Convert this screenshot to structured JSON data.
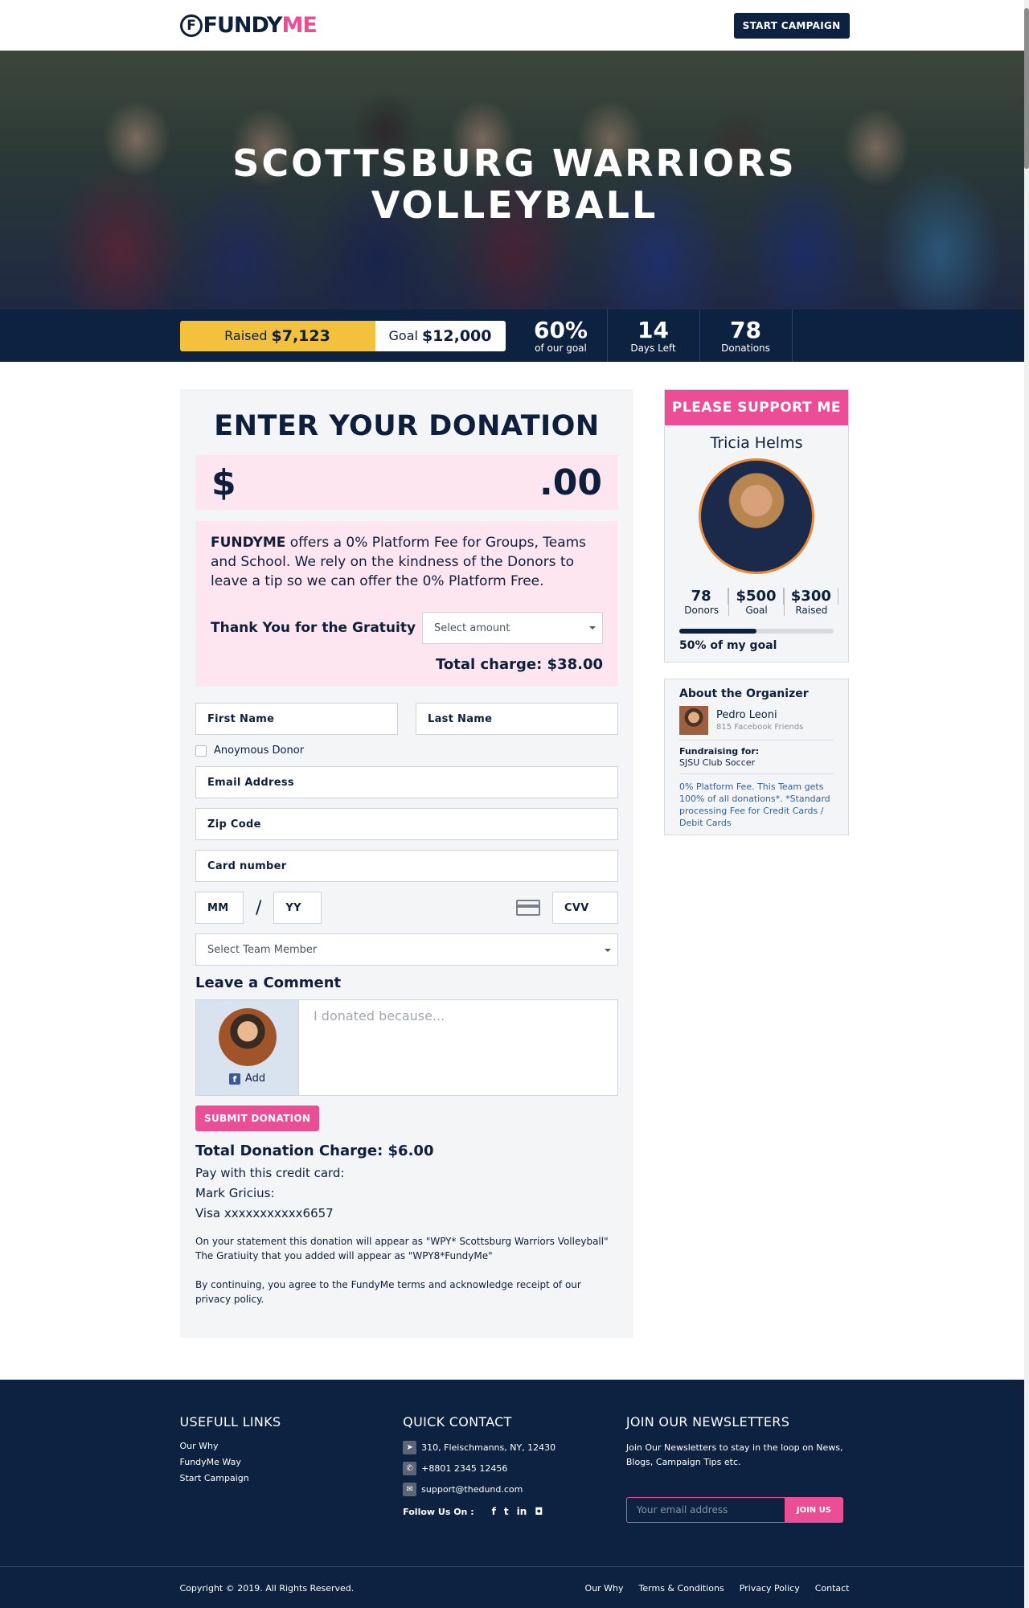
{
  "header": {
    "logo_mark": "F",
    "logo_fundy": "FUNDY",
    "logo_me": "ME",
    "start_campaign": "START CAMPAIGN"
  },
  "hero": {
    "title_line1": "SCOTTSBURG WARRIORS",
    "title_line2": "VOLLEYBALL"
  },
  "stats": {
    "raised_label": "Raised",
    "raised_value": "$7,123",
    "goal_label": "Goal",
    "goal_value": "$12,000",
    "items": [
      {
        "value": "60%",
        "label": "of our goal"
      },
      {
        "value": "14",
        "label": "Days Left"
      },
      {
        "value": "78",
        "label": "Donations"
      }
    ]
  },
  "donation": {
    "title": "ENTER YOUR DONATION",
    "currency": "$",
    "cents": ".00",
    "fee_brand": "FUNDYME",
    "fee_text": " offers a 0% Platform Fee for Groups, Teams and School. We rely on the kindness of the Donors to leave a tip so we can offer the 0% Platform Free.",
    "gratuity_label": "Thank You for the Gratuity",
    "gratuity_select": "Select amount",
    "total_charge": "Total charge: $38.00",
    "first_name": "First Name",
    "last_name": "Last Name",
    "anonymous": "Anoymous Donor",
    "email": "Email Address",
    "zip": "Zip Code",
    "card_number": "Card number",
    "mm": "MM",
    "slash": "/",
    "yy": "YY",
    "cvv": "CVV",
    "team_member": "Select Team Member",
    "comment_title": "Leave a Comment",
    "fb_add": "Add",
    "comment_placeholder": "I donated because...",
    "submit": "SUBMIT DONATION",
    "total_donation": "Total Donation Charge: $6.00",
    "pay_line1": "Pay with this credit card:",
    "pay_line2": "Mark Gricius:",
    "pay_line3": "Visa xxxxxxxxxxx6657",
    "statement": "On your statement this donation will appear as \"WPY* Scottsburg Warriors Volleyball\" The Gratiuity that you added will appear as \"WPY8*FundyMe\"",
    "terms": "By continuing, you agree to the FundyMe terms and acknowledge receipt of our privacy policy."
  },
  "support": {
    "header": "PLEASE SUPPORT ME",
    "name": "Tricia Helms",
    "stats": [
      {
        "value": "78",
        "label": "Donors"
      },
      {
        "value": "$500",
        "label": "Goal"
      },
      {
        "value": "$300",
        "label": "Raised"
      }
    ],
    "progress": 0.5,
    "progress_label": "50% of my goal"
  },
  "organizer": {
    "title": "About the Organizer",
    "name": "Pedro Leoni",
    "friends": "815 Facebook Friends",
    "for_label": "Fundraising for:",
    "for_value": "SJSU Club Soccer",
    "note": "0% Platform Fee. This Team gets 100% of all donations*. *Standard processing Fee for Credit Cards / Debit Cards"
  },
  "footer": {
    "links_title": "USEFULL LINKS",
    "links": [
      "Our Why",
      "FundyMe Way",
      "Start Campaign"
    ],
    "contact_title": "QUICK CONTACT",
    "address": "310, Fleischmanns, NY, 12430",
    "phone": "+8801 2345 12456",
    "email": "support@thedund.com",
    "follow": "Follow Us On :",
    "newsletter_title": "JOIN OUR NEWSLETTERS",
    "newsletter_text": "Join Our Newsletters to stay in the loop on News, Blogs, Campaign Tips etc.",
    "newsletter_placeholder": "Your email address",
    "join": "JOIN US",
    "copyright": "Copyright © 2019. All Rights Reserved.",
    "bottom_links": [
      "Our Why",
      "Terms & Conditions",
      "Privacy Policy",
      "Contact"
    ]
  }
}
